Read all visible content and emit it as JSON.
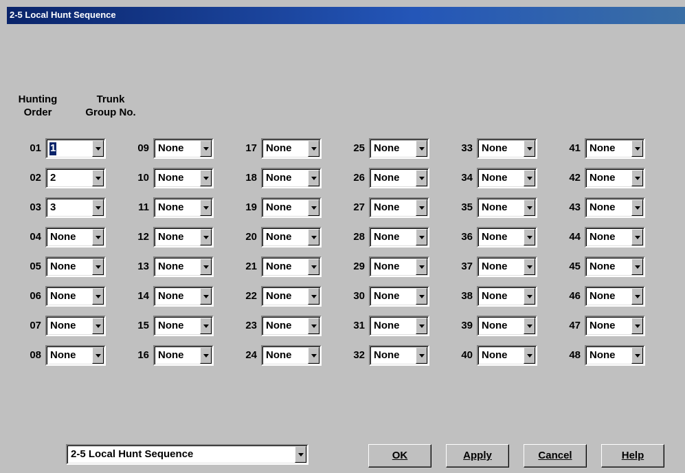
{
  "window": {
    "title": "2-5 Local Hunt Sequence"
  },
  "headers": {
    "hunting_order": "Hunting\nOrder",
    "trunk_group": "Trunk\nGroup No."
  },
  "entries": [
    {
      "order": "01",
      "value": "1",
      "selected": true
    },
    {
      "order": "02",
      "value": "2"
    },
    {
      "order": "03",
      "value": "3"
    },
    {
      "order": "04",
      "value": "None"
    },
    {
      "order": "05",
      "value": "None"
    },
    {
      "order": "06",
      "value": "None"
    },
    {
      "order": "07",
      "value": "None"
    },
    {
      "order": "08",
      "value": "None"
    },
    {
      "order": "09",
      "value": "None"
    },
    {
      "order": "10",
      "value": "None"
    },
    {
      "order": "11",
      "value": "None"
    },
    {
      "order": "12",
      "value": "None"
    },
    {
      "order": "13",
      "value": "None"
    },
    {
      "order": "14",
      "value": "None"
    },
    {
      "order": "15",
      "value": "None"
    },
    {
      "order": "16",
      "value": "None"
    },
    {
      "order": "17",
      "value": "None"
    },
    {
      "order": "18",
      "value": "None"
    },
    {
      "order": "19",
      "value": "None"
    },
    {
      "order": "20",
      "value": "None"
    },
    {
      "order": "21",
      "value": "None"
    },
    {
      "order": "22",
      "value": "None"
    },
    {
      "order": "23",
      "value": "None"
    },
    {
      "order": "24",
      "value": "None"
    },
    {
      "order": "25",
      "value": "None"
    },
    {
      "order": "26",
      "value": "None"
    },
    {
      "order": "27",
      "value": "None"
    },
    {
      "order": "28",
      "value": "None"
    },
    {
      "order": "29",
      "value": "None"
    },
    {
      "order": "30",
      "value": "None"
    },
    {
      "order": "31",
      "value": "None"
    },
    {
      "order": "32",
      "value": "None"
    },
    {
      "order": "33",
      "value": "None"
    },
    {
      "order": "34",
      "value": "None"
    },
    {
      "order": "35",
      "value": "None"
    },
    {
      "order": "36",
      "value": "None"
    },
    {
      "order": "37",
      "value": "None"
    },
    {
      "order": "38",
      "value": "None"
    },
    {
      "order": "39",
      "value": "None"
    },
    {
      "order": "40",
      "value": "None"
    },
    {
      "order": "41",
      "value": "None"
    },
    {
      "order": "42",
      "value": "None"
    },
    {
      "order": "43",
      "value": "None"
    },
    {
      "order": "44",
      "value": "None"
    },
    {
      "order": "45",
      "value": "None"
    },
    {
      "order": "46",
      "value": "None"
    },
    {
      "order": "47",
      "value": "None"
    },
    {
      "order": "48",
      "value": "None"
    }
  ],
  "page_selector": {
    "value": "2-5 Local Hunt Sequence"
  },
  "buttons": {
    "ok": "OK",
    "apply": "Apply",
    "cancel": "Cancel",
    "help": "Help"
  },
  "colors": {
    "face": "#c0c0c0",
    "title_start": "#0a246a",
    "title_end": "#3a6ea5",
    "selection": "#0a246a"
  }
}
